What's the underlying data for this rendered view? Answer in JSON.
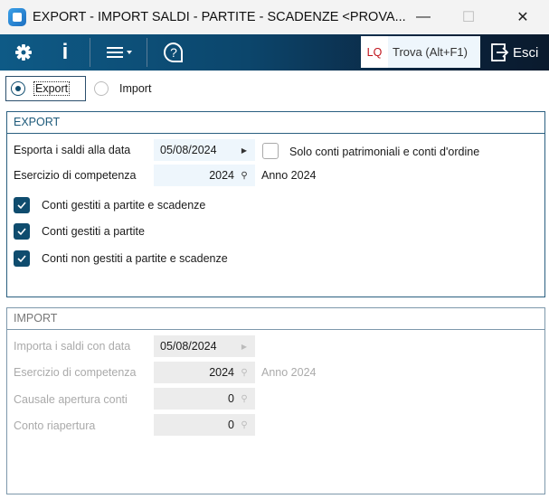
{
  "window": {
    "title": "EXPORT - IMPORT SALDI - PARTITE - SCADENZE <PROVA...",
    "minimize": "—",
    "maximize": "☐",
    "close": "✕"
  },
  "toolbar": {
    "lq": "LQ",
    "search_placeholder": "Trova (Alt+F1)",
    "exit": "Esci"
  },
  "mode": {
    "export": "Export",
    "import": "Import",
    "selected": "export"
  },
  "export": {
    "title": "EXPORT",
    "date_label": "Esporta i saldi alla data",
    "date_value": "05/08/2024",
    "only_patrimonial_label": "Solo conti patrimoniali e conti d'ordine",
    "only_patrimonial_checked": false,
    "year_label": "Esercizio di competenza",
    "year_value": "2024",
    "year_desc": "Anno 2024",
    "checks": [
      {
        "label": "Conti gestiti a partite e scadenze",
        "checked": true
      },
      {
        "label": "Conti gestiti a partite",
        "checked": true
      },
      {
        "label": "Conti non gestiti a partite e scadenze",
        "checked": true
      }
    ]
  },
  "import": {
    "title": "IMPORT",
    "date_label": "Importa i saldi con data",
    "date_value": "05/08/2024",
    "year_label": "Esercizio di competenza",
    "year_value": "2024",
    "year_desc": "Anno 2024",
    "causale_label": "Causale apertura conti",
    "causale_value": "0",
    "conto_label": "Conto riapertura",
    "conto_value": "0"
  }
}
